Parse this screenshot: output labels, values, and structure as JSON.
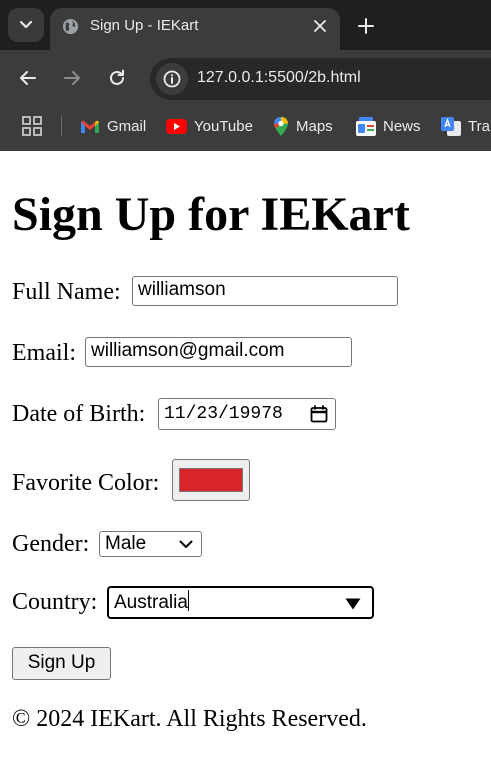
{
  "browser": {
    "tab": {
      "title": "Sign Up - IEKart"
    },
    "address_bar": {
      "url": "127.0.0.1:5500/2b.html"
    },
    "bookmarks": [
      {
        "label": "Gmail",
        "icon": "gmail-icon"
      },
      {
        "label": "YouTube",
        "icon": "youtube-icon"
      },
      {
        "label": "Maps",
        "icon": "maps-icon"
      },
      {
        "label": "News",
        "icon": "news-icon"
      },
      {
        "label": "Tran",
        "icon": "translate-icon"
      }
    ],
    "colors": {
      "tab_strip": "#1f1f1f",
      "toolbar": "#3c3c3c",
      "omnibox": "#282828",
      "text": "#e8eaed"
    }
  },
  "page": {
    "title": "Sign Up for IEKart",
    "form": {
      "full_name": {
        "label": "Full Name:",
        "value": "williamson"
      },
      "email": {
        "label": "Email:",
        "value": "williamson@gmail.com"
      },
      "dob": {
        "label": "Date of Birth:",
        "value": "11/23/19978"
      },
      "favorite_color": {
        "label": "Favorite Color:",
        "value": "#d9262a"
      },
      "gender": {
        "label": "Gender:",
        "value": "Male"
      },
      "country": {
        "label": "Country:",
        "value": "Australia"
      },
      "submit_label": "Sign Up"
    },
    "footer": "© 2024 IEKart. All Rights Reserved."
  }
}
